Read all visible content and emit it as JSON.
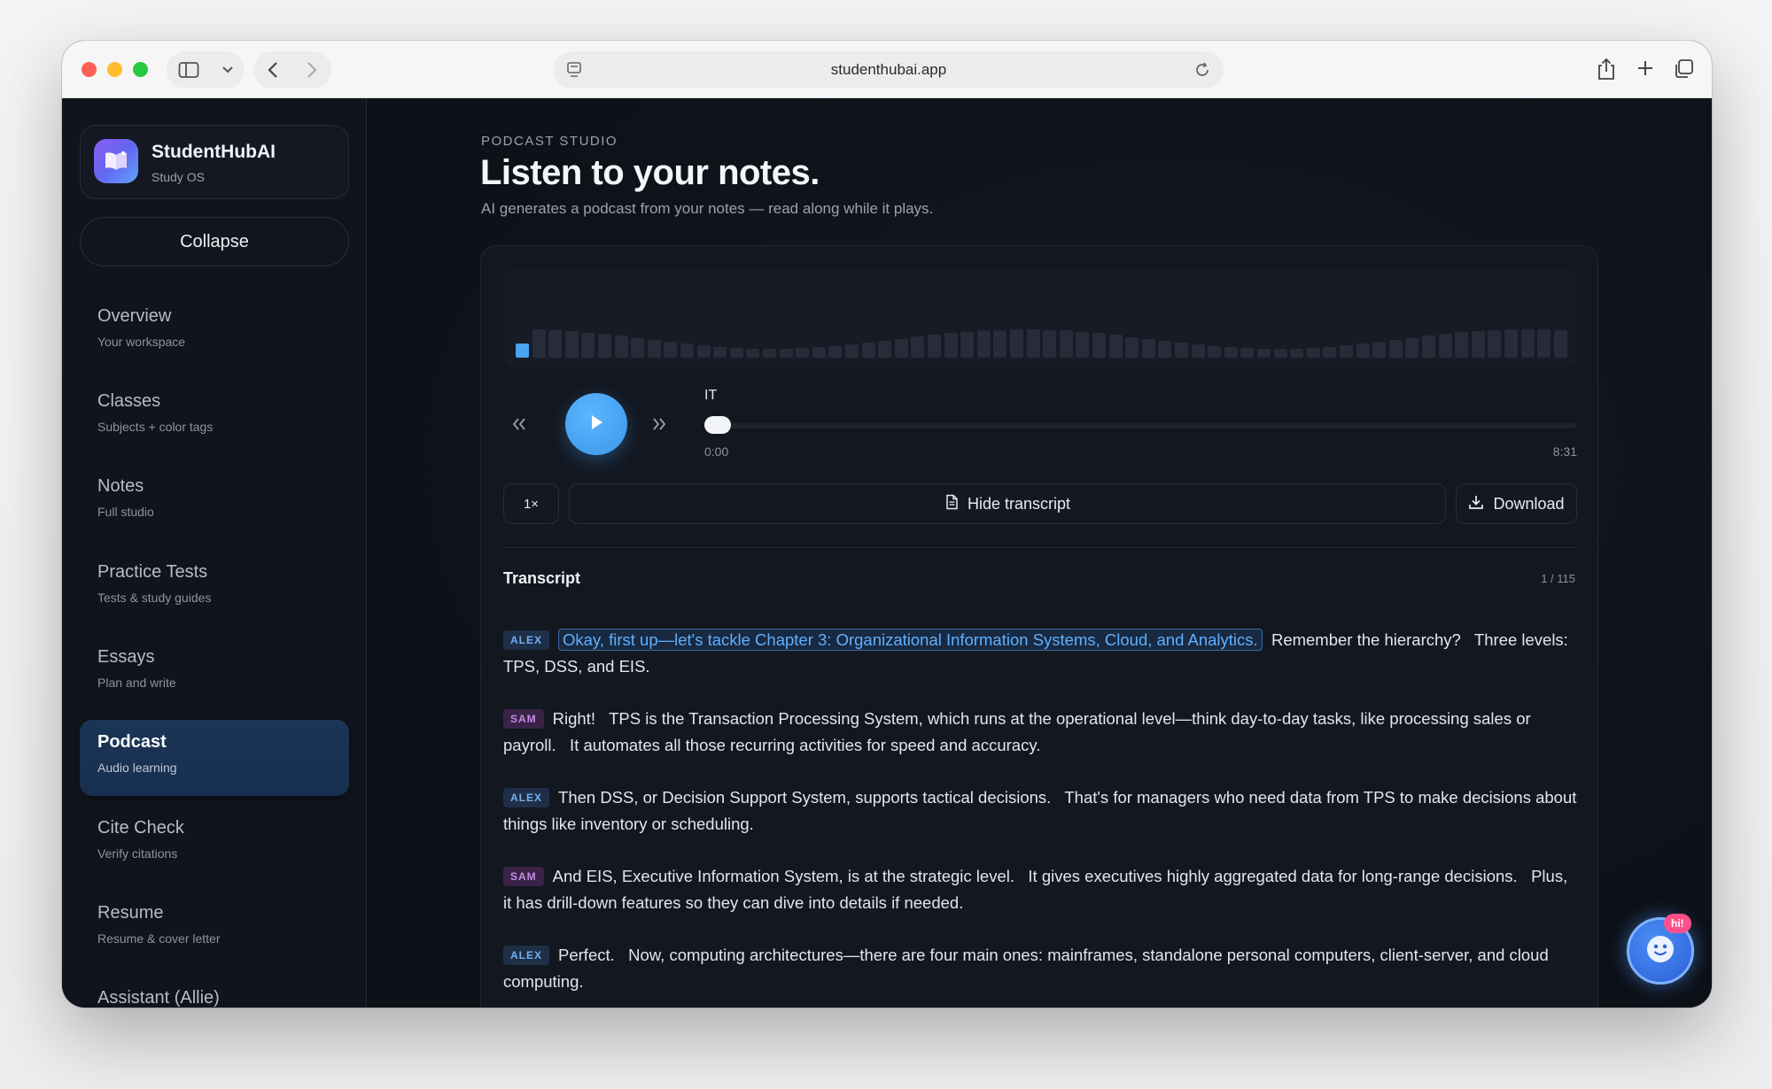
{
  "browser": {
    "url": "studenthubai.app"
  },
  "brand": {
    "name": "StudentHubAI",
    "subtitle": "Study OS"
  },
  "sidebar": {
    "collapse_label": "Collapse",
    "items": [
      {
        "label": "Overview",
        "sub": "Your workspace"
      },
      {
        "label": "Classes",
        "sub": "Subjects + color tags"
      },
      {
        "label": "Notes",
        "sub": "Full studio"
      },
      {
        "label": "Practice Tests",
        "sub": "Tests & study guides"
      },
      {
        "label": "Essays",
        "sub": "Plan and write"
      },
      {
        "label": "Podcast",
        "sub": "Audio learning",
        "active": true
      },
      {
        "label": "Cite Check",
        "sub": "Verify citations"
      },
      {
        "label": "Resume",
        "sub": "Resume & cover letter"
      },
      {
        "label": "Assistant (Allie)",
        "sub": ""
      }
    ]
  },
  "page": {
    "eyebrow": "PODCAST STUDIO",
    "title": "Listen to your notes.",
    "subtitle": "AI generates a podcast from your notes — read along while it plays."
  },
  "player": {
    "track_title": "IT",
    "current_time": "0:00",
    "total_time": "8:31",
    "progress": 0,
    "speed_label": "1×",
    "transcript_toggle_label": "Hide transcript",
    "download_label": "Download",
    "accent_color": "#4aa3f3"
  },
  "transcript": {
    "title": "Transcript",
    "count": "1 / 115",
    "lines": [
      {
        "speaker": "ALEX",
        "highlight": "Okay, first up—let's tackle Chapter 3: Organizational Information Systems, Cloud, and Analytics.",
        "text": "Remember the hierarchy?   Three levels: TPS, DSS, and EIS."
      },
      {
        "speaker": "SAM",
        "highlight": "",
        "text": "Right!   TPS is the Transaction Processing System, which runs at the operational level—think day-to-day tasks, like processing sales or payroll.   It automates all those recurring activities for speed and accuracy."
      },
      {
        "speaker": "ALEX",
        "highlight": "",
        "text": "Then DSS, or Decision Support System, supports tactical decisions.   That's for managers who need data from TPS to make decisions about things like inventory or scheduling."
      },
      {
        "speaker": "SAM",
        "highlight": "",
        "text": "And EIS, Executive Information System, is at the strategic level.   It gives executives highly aggregated data for long-range decisions.   Plus, it has drill-down features so they can dive into details if needed."
      },
      {
        "speaker": "ALEX",
        "highlight": "",
        "text": "Perfect.   Now, computing architectures—there are four main ones: mainframes, standalone personal computers, client-server, and cloud computing."
      }
    ]
  },
  "assistant_fab": {
    "badge": "hi!"
  }
}
